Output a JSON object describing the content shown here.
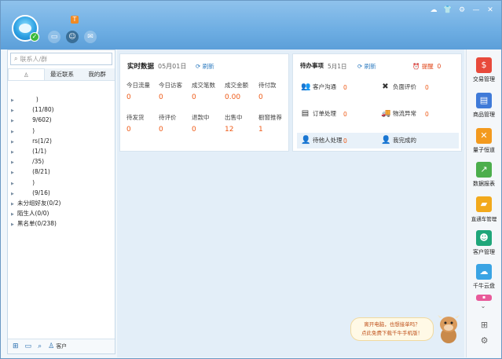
{
  "window": {
    "controls": [
      "☁",
      "👕",
      "⚙",
      "—",
      "✕"
    ]
  },
  "toolbar": {
    "badge": "T"
  },
  "left_panel": {
    "search_placeholder": "联系人/群",
    "tabs": [
      "",
      "最近联系",
      "我的群"
    ],
    "groups": [
      "          )",
      "        (11/80)",
      "        9/602)",
      "        )",
      "        rs(1/2)",
      "        (1/1)",
      "        /35)",
      "        (8/21)",
      "        )",
      "        (9/16)",
      "未分组好友(0/2)",
      "陌生人(0/0)",
      "黑名单(0/238)"
    ],
    "footer_label": "客户"
  },
  "realtime": {
    "title": "实时数据",
    "date": "05月01日",
    "refresh": "刷新",
    "stats": [
      {
        "label": "今日流量",
        "value": "0"
      },
      {
        "label": "今日访客",
        "value": "0"
      },
      {
        "label": "成交笔数",
        "value": "0"
      },
      {
        "label": "成交金额",
        "value": "0.00"
      },
      {
        "label": "待付款",
        "value": "0"
      },
      {
        "label": "待发货",
        "value": "0"
      },
      {
        "label": "待评价",
        "value": "0"
      },
      {
        "label": "退款中",
        "value": "0"
      },
      {
        "label": "出售中",
        "value": "12"
      },
      {
        "label": "橱窗推荐",
        "value": "1"
      }
    ]
  },
  "todo": {
    "title": "待办事项",
    "date": "5月1日",
    "refresh": "刷新",
    "alarm_label": "提醒",
    "alarm_count": "0",
    "items": [
      {
        "label": "客户沟通",
        "count": "0"
      },
      {
        "label": "负面评价",
        "count": "0"
      },
      {
        "label": "订单处理",
        "count": "0"
      },
      {
        "label": "物流异常",
        "count": "0"
      },
      {
        "label": "待他人处理",
        "count": "0"
      },
      {
        "label": "我完成的",
        "count": ""
      }
    ]
  },
  "sidebar": {
    "items": [
      {
        "label": "交易管理",
        "color": "#e84a3b",
        "icon": "$"
      },
      {
        "label": "商品管理",
        "color": "#3f7ad8",
        "icon": "▤"
      },
      {
        "label": "量子恒道",
        "color": "#f39a1e",
        "icon": "✕"
      },
      {
        "label": "数据报表",
        "color": "#4cae4c",
        "icon": "↗"
      },
      {
        "label": "直通车管理",
        "color": "#f2a91c",
        "icon": "▰"
      },
      {
        "label": "客户管理",
        "color": "#1fa67a",
        "icon": "☻"
      },
      {
        "label": "千牛云盘",
        "color": "#3aa4e4",
        "icon": "☁"
      }
    ]
  },
  "promo": {
    "line1": "离开电脑，也想接单吗？",
    "line2": "点此免费下载千牛手机版！"
  }
}
